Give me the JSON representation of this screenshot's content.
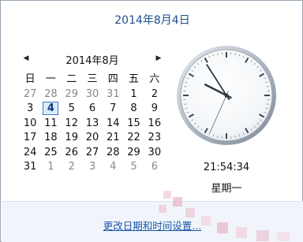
{
  "header": {
    "full_date": "2014年8月4日"
  },
  "calendar": {
    "month_label": "2014年8月",
    "prev_icon": "triangle-left-icon",
    "next_icon": "triangle-right-icon",
    "weekdays": [
      "日",
      "一",
      "二",
      "三",
      "四",
      "五",
      "六"
    ],
    "weeks": [
      [
        {
          "d": "27",
          "m": true
        },
        {
          "d": "28",
          "m": true
        },
        {
          "d": "29",
          "m": true
        },
        {
          "d": "30",
          "m": true
        },
        {
          "d": "31",
          "m": true
        },
        {
          "d": "1",
          "m": false
        },
        {
          "d": "2",
          "m": false
        }
      ],
      [
        {
          "d": "3",
          "m": false
        },
        {
          "d": "4",
          "m": false,
          "today": true
        },
        {
          "d": "5",
          "m": false
        },
        {
          "d": "6",
          "m": false
        },
        {
          "d": "7",
          "m": false
        },
        {
          "d": "8",
          "m": false
        },
        {
          "d": "9",
          "m": false
        }
      ],
      [
        {
          "d": "10",
          "m": false
        },
        {
          "d": "11",
          "m": false
        },
        {
          "d": "12",
          "m": false
        },
        {
          "d": "13",
          "m": false
        },
        {
          "d": "14",
          "m": false
        },
        {
          "d": "15",
          "m": false
        },
        {
          "d": "16",
          "m": false
        }
      ],
      [
        {
          "d": "17",
          "m": false
        },
        {
          "d": "18",
          "m": false
        },
        {
          "d": "19",
          "m": false
        },
        {
          "d": "20",
          "m": false
        },
        {
          "d": "21",
          "m": false
        },
        {
          "d": "22",
          "m": false
        },
        {
          "d": "23",
          "m": false
        }
      ],
      [
        {
          "d": "24",
          "m": false
        },
        {
          "d": "25",
          "m": false
        },
        {
          "d": "26",
          "m": false
        },
        {
          "d": "27",
          "m": false
        },
        {
          "d": "28",
          "m": false
        },
        {
          "d": "29",
          "m": false
        },
        {
          "d": "30",
          "m": false
        }
      ],
      [
        {
          "d": "31",
          "m": false
        },
        {
          "d": "1",
          "m": true
        },
        {
          "d": "2",
          "m": true
        },
        {
          "d": "3",
          "m": true
        },
        {
          "d": "4",
          "m": true
        },
        {
          "d": "5",
          "m": true
        },
        {
          "d": "6",
          "m": true
        }
      ]
    ]
  },
  "clock": {
    "time": "21:54:34",
    "weekday": "星期一",
    "hours": 21,
    "minutes": 54,
    "seconds": 34
  },
  "footer": {
    "link": "更改日期和时间设置..."
  },
  "colors": {
    "accent": "#1e4f8c",
    "today_border": "#3a78c9",
    "today_fill": "#dcebfb",
    "link": "#1a56a8"
  }
}
